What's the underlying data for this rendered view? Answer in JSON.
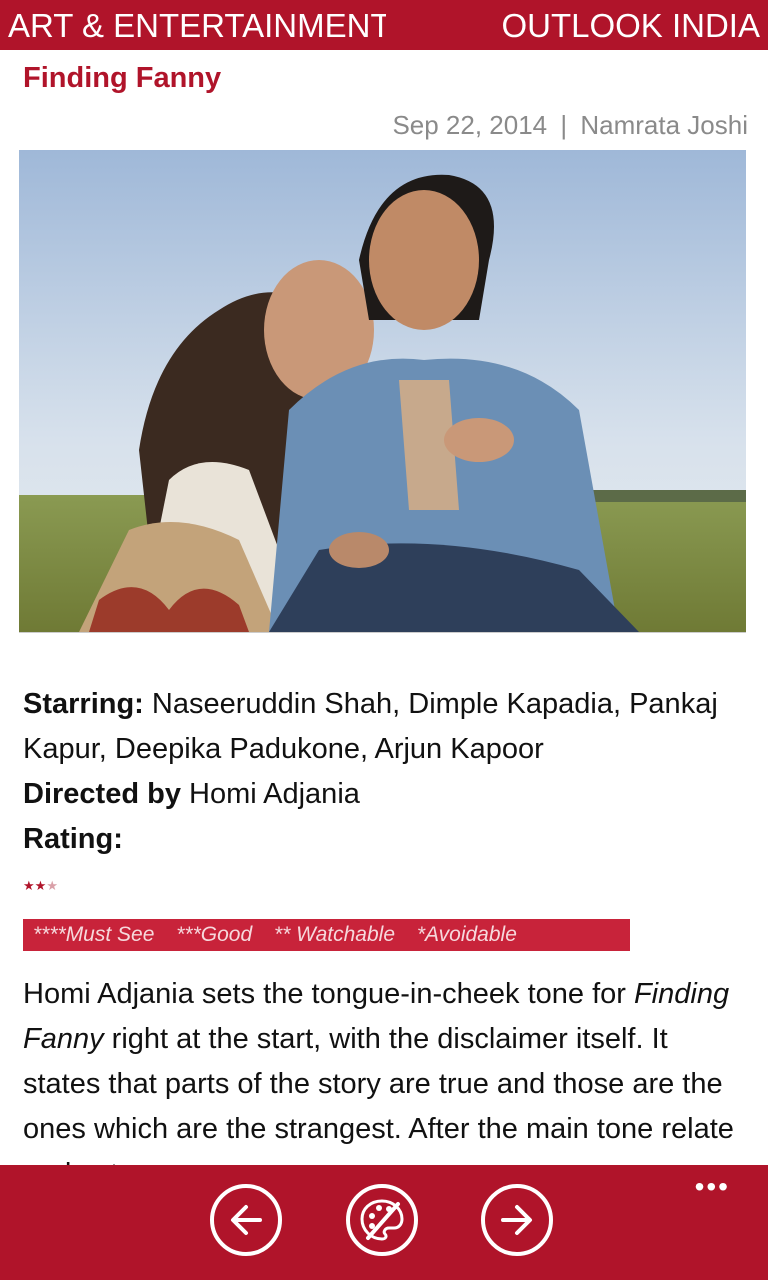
{
  "header": {
    "section": "ART & ENTERTAINMENT",
    "brand": "OUTLOOK INDIA"
  },
  "article": {
    "title": "Finding Fanny",
    "date": "Sep 22, 2014",
    "separator": "|",
    "author": "Namrata Joshi",
    "starring_label": "Starring:",
    "starring": "Naseeruddin Shah, Dimple Kapadia, Pankaj Kapur, Deepika Padukone, Arjun Kapoor",
    "directed_label": "Directed by",
    "director": "Homi Adjania",
    "rating_label": "Rating:",
    "rating_stars": 2.5,
    "rating_max": 3,
    "legend": [
      "****Must See",
      "***Good",
      "** Watchable",
      "*Avoidable"
    ],
    "body_intro": "Homi Adjania sets the tongue-in-cheek tone for ",
    "body_italic": "Finding Fanny",
    "body_rest": " right at the start, with the disclaimer itself. It states that parts of the story are true and those are the ones which are the strangest. After the main tone relate and set..."
  },
  "appbar": {
    "icons": [
      "back-arrow-icon",
      "palette-icon",
      "forward-arrow-icon"
    ],
    "more": "•••"
  },
  "colors": {
    "accent": "#b0142a",
    "byline": "#8a8a8a"
  }
}
